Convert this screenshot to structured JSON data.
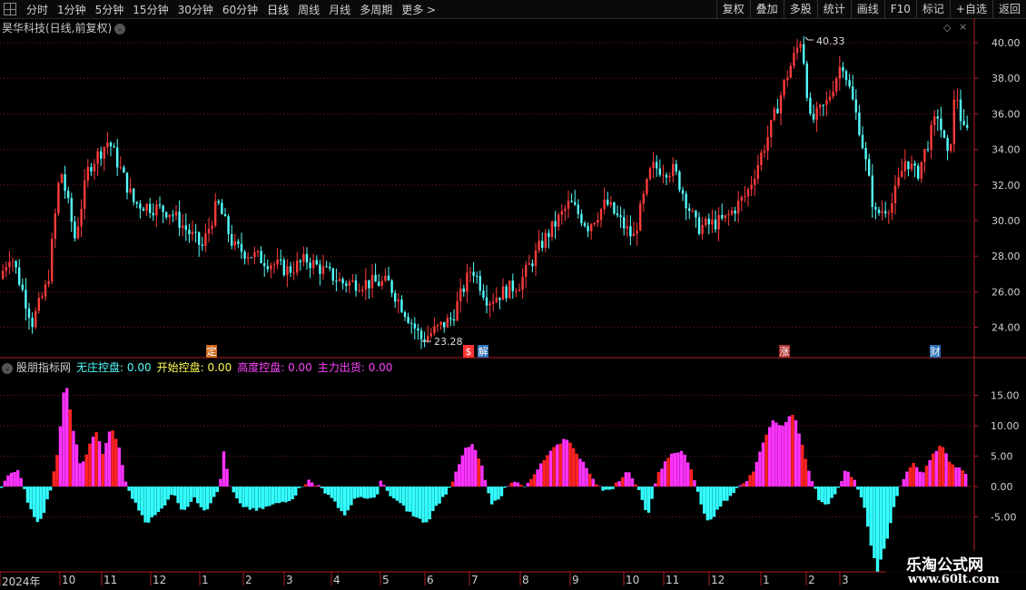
{
  "toolbar": {
    "periods": [
      "分时",
      "1分钟",
      "5分钟",
      "15分钟",
      "30分钟",
      "60分钟",
      "日线",
      "周线",
      "月线",
      "多周期",
      "更多"
    ],
    "active_period": "日线",
    "more_arrow": ">",
    "right_buttons": [
      "复权",
      "叠加",
      "多股",
      "统计",
      "画线",
      "F10",
      "标记",
      "+自选",
      "返回"
    ]
  },
  "chart": {
    "title": "昊华科技(日线,前复权)",
    "high_label": "40.33",
    "low_label": "23.28",
    "price_ticks": [
      "40.00",
      "38.00",
      "36.00",
      "34.00",
      "32.00",
      "30.00",
      "28.00",
      "26.00",
      "24.00"
    ],
    "markers": [
      {
        "label": "定",
        "color": "#d2691e"
      },
      {
        "label": "$",
        "color": "#ff3333"
      },
      {
        "label": "解",
        "color": "#2a6fb5"
      },
      {
        "label": "涨",
        "color": "#b03030"
      },
      {
        "label": "财",
        "color": "#2a6fb5"
      }
    ]
  },
  "indicator": {
    "name": "股朋指标网",
    "lines": [
      {
        "label": "无庄控盘:",
        "value": "0.00",
        "color": "#55ffff"
      },
      {
        "label": "开始控盘:",
        "value": "0.00",
        "color": "#ffff55"
      },
      {
        "label": "高度控盘:",
        "value": "0.00",
        "color": "#ff44ff"
      },
      {
        "label": "主力出货:",
        "value": "0.00",
        "color": "#ff44ff"
      }
    ],
    "ticks": [
      "15.00",
      "10.00",
      "5.00",
      "0.00",
      "-5.00"
    ]
  },
  "date_axis": [
    "2024年",
    "10",
    "11",
    "12",
    "1",
    "2",
    "3",
    "4",
    "5",
    "6",
    "7",
    "8",
    "9",
    "10",
    "11",
    "12",
    "1",
    "2",
    "3"
  ],
  "watermark": {
    "line1": "乐淘公式网",
    "line2": "www.60lt.com"
  },
  "colors": {
    "up": "#ff3b3b",
    "down": "#54ffff",
    "grid": "#7a1a1a",
    "magenta": "#ff33ff",
    "cyan": "#33ffff",
    "red": "#ff2222"
  }
}
